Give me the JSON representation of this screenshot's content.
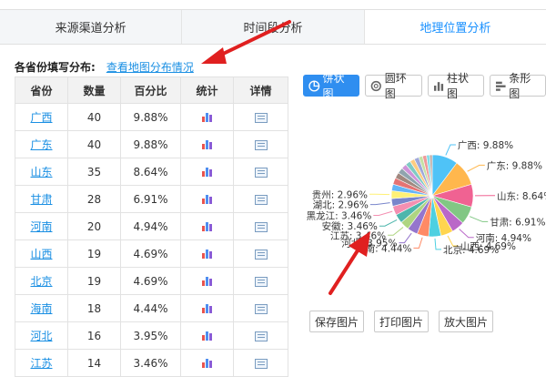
{
  "tabs": [
    {
      "label": "来源渠道分析"
    },
    {
      "label": "时间段分析"
    },
    {
      "label": "地理位置分析"
    }
  ],
  "heading": "各省份填写分布:",
  "map_link": "查看地图分布情况",
  "table": {
    "headers": [
      "省份",
      "数量",
      "百分比",
      "统计",
      "详情"
    ],
    "rows": [
      {
        "province": "广西",
        "count": "40",
        "percent": "9.88%"
      },
      {
        "province": "广东",
        "count": "40",
        "percent": "9.88%"
      },
      {
        "province": "山东",
        "count": "35",
        "percent": "8.64%"
      },
      {
        "province": "甘肃",
        "count": "28",
        "percent": "6.91%"
      },
      {
        "province": "河南",
        "count": "20",
        "percent": "4.94%"
      },
      {
        "province": "山西",
        "count": "19",
        "percent": "4.69%"
      },
      {
        "province": "北京",
        "count": "19",
        "percent": "4.69%"
      },
      {
        "province": "海南",
        "count": "18",
        "percent": "4.44%"
      },
      {
        "province": "河北",
        "count": "16",
        "percent": "3.95%"
      },
      {
        "province": "江苏",
        "count": "14",
        "percent": "3.46%"
      }
    ]
  },
  "chart_buttons": [
    {
      "label": "饼状图",
      "icon": "pie-icon",
      "active": true
    },
    {
      "label": "圆环图",
      "icon": "ring-icon",
      "active": false
    },
    {
      "label": "柱状图",
      "icon": "column-icon",
      "active": false
    },
    {
      "label": "条形图",
      "icon": "bar-icon",
      "active": false
    }
  ],
  "bottom_buttons": [
    {
      "label": "保存图片"
    },
    {
      "label": "打印图片"
    },
    {
      "label": "放大图片"
    }
  ],
  "colors": {
    "accent": "#1890ff",
    "link": "#1a8fe3",
    "arrow": "#e02020",
    "bar_icon": [
      "#e8544f",
      "#4f8ef0",
      "#8a5bd6"
    ]
  },
  "chart_data": {
    "type": "pie",
    "labeled_slices": [
      {
        "name": "广西",
        "value": 9.88,
        "label": "广西: 9.88%",
        "color": "#4fc3f7"
      },
      {
        "name": "广东",
        "value": 9.88,
        "label": "广东: 9.88%",
        "color": "#ffb74d"
      },
      {
        "name": "山东",
        "value": 8.64,
        "label": "山东: 8.64%",
        "color": "#f06292"
      },
      {
        "name": "甘肃",
        "value": 6.91,
        "label": "甘肃: 6.91%",
        "color": "#81c784"
      },
      {
        "name": "河南",
        "value": 4.94,
        "label": "河南: 4.94%",
        "color": "#ba68c8"
      },
      {
        "name": "山西",
        "value": 4.69,
        "label": "山西: 4.69%",
        "color": "#ffd54f"
      },
      {
        "name": "北京",
        "value": 4.69,
        "label": "北京: 4.69%",
        "color": "#4dd0e1"
      },
      {
        "name": "海南",
        "value": 4.44,
        "label": "海南: 4.44%",
        "color": "#ff8a65"
      },
      {
        "name": "河北",
        "value": 3.95,
        "label": "河北: 3.95%",
        "color": "#9575cd"
      },
      {
        "name": "江苏",
        "value": 3.46,
        "label": "江苏: 3.46%",
        "color": "#aed581"
      },
      {
        "name": "安徽",
        "value": 3.46,
        "label": "安徽: 3.46%",
        "color": "#4db6ac"
      },
      {
        "name": "黑龙江",
        "value": 3.46,
        "label": "黑龙江: 3.46%",
        "color": "#f48fb1"
      },
      {
        "name": "湖北",
        "value": 2.96,
        "label": "湖北: 2.96%",
        "color": "#7986cb"
      },
      {
        "name": "贵州",
        "value": 2.96,
        "label": "贵州: 2.96%",
        "color": "#fff176"
      }
    ],
    "unlabeled_slices": [
      {
        "value": 2.5,
        "color": "#64b5f6"
      },
      {
        "value": 2.5,
        "color": "#e57373"
      },
      {
        "value": 2.2,
        "color": "#a1887f"
      },
      {
        "value": 2.2,
        "color": "#90a4ae"
      },
      {
        "value": 2.0,
        "color": "#ce93d8"
      },
      {
        "value": 2.0,
        "color": "#80cbc4"
      },
      {
        "value": 1.8,
        "color": "#ffcc80"
      },
      {
        "value": 1.8,
        "color": "#9fa8da"
      },
      {
        "value": 1.5,
        "color": "#c5e1a5"
      },
      {
        "value": 1.5,
        "color": "#ef9a9a"
      },
      {
        "value": 1.2,
        "color": "#80deea"
      },
      {
        "value": 1.0,
        "color": "#bcaaa4"
      }
    ]
  }
}
